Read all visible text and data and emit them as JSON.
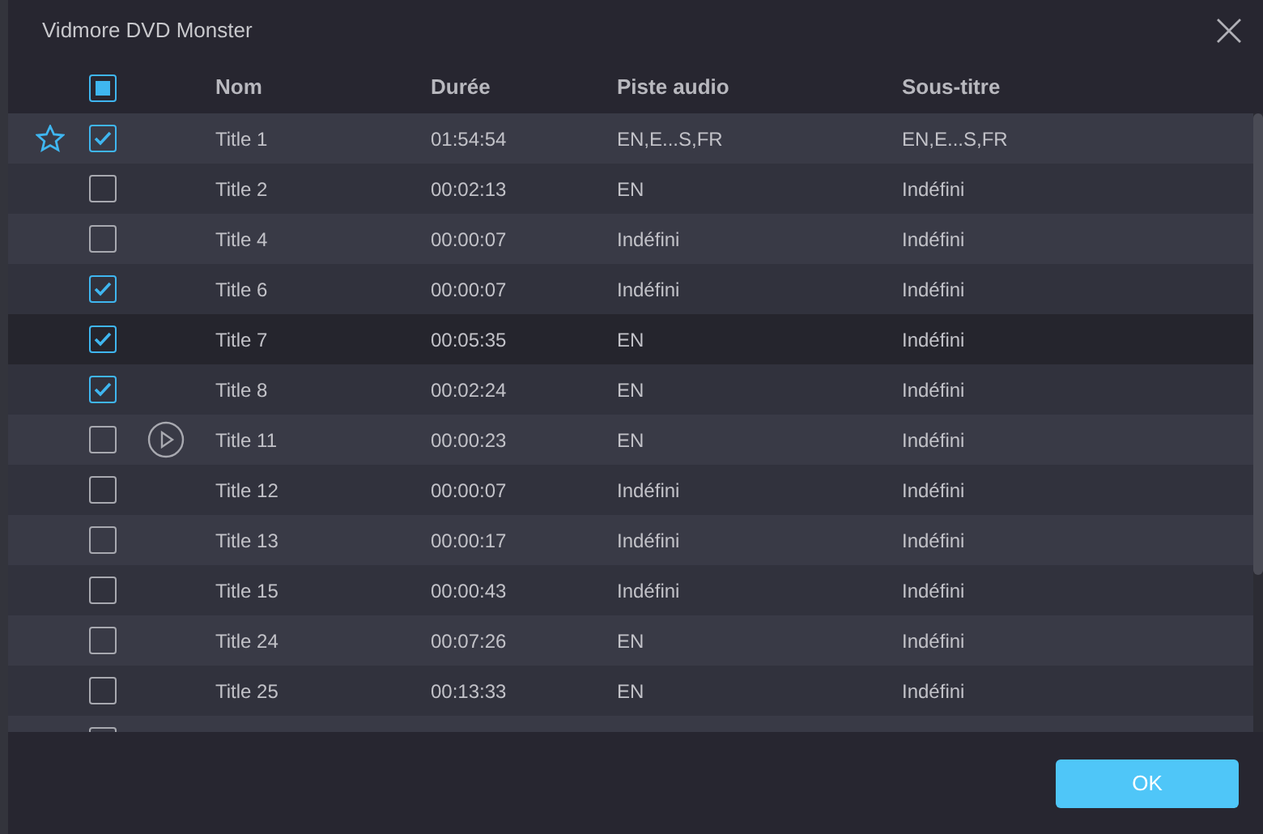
{
  "window": {
    "title": "Vidmore DVD Monster"
  },
  "table": {
    "select_all": {
      "indeterminate": true
    },
    "columns": [
      "Nom",
      "Durée",
      "Piste audio",
      "Sous-titre"
    ],
    "rows": [
      {
        "checked": true,
        "starred": true,
        "preview": false,
        "selected": false,
        "cells": [
          "Title 1",
          "01:54:54",
          "EN,E...S,FR",
          "EN,E...S,FR"
        ]
      },
      {
        "checked": false,
        "starred": false,
        "preview": false,
        "selected": false,
        "cells": [
          "Title 2",
          "00:02:13",
          "EN",
          "Indéfini"
        ]
      },
      {
        "checked": false,
        "starred": false,
        "preview": false,
        "selected": false,
        "cells": [
          "Title 4",
          "00:00:07",
          "Indéfini",
          "Indéfini"
        ]
      },
      {
        "checked": true,
        "starred": false,
        "preview": false,
        "selected": false,
        "cells": [
          "Title 6",
          "00:00:07",
          "Indéfini",
          "Indéfini"
        ]
      },
      {
        "checked": true,
        "starred": false,
        "preview": false,
        "selected": true,
        "cells": [
          "Title 7",
          "00:05:35",
          "EN",
          "Indéfini"
        ]
      },
      {
        "checked": true,
        "starred": false,
        "preview": false,
        "selected": false,
        "cells": [
          "Title 8",
          "00:02:24",
          "EN",
          "Indéfini"
        ]
      },
      {
        "checked": false,
        "starred": false,
        "preview": true,
        "selected": false,
        "cells": [
          "Title 11",
          "00:00:23",
          "EN",
          "Indéfini"
        ]
      },
      {
        "checked": false,
        "starred": false,
        "preview": false,
        "selected": false,
        "cells": [
          "Title 12",
          "00:00:07",
          "Indéfini",
          "Indéfini"
        ]
      },
      {
        "checked": false,
        "starred": false,
        "preview": false,
        "selected": false,
        "cells": [
          "Title 13",
          "00:00:17",
          "Indéfini",
          "Indéfini"
        ]
      },
      {
        "checked": false,
        "starred": false,
        "preview": false,
        "selected": false,
        "cells": [
          "Title 15",
          "00:00:43",
          "Indéfini",
          "Indéfini"
        ]
      },
      {
        "checked": false,
        "starred": false,
        "preview": false,
        "selected": false,
        "cells": [
          "Title 24",
          "00:07:26",
          "EN",
          "Indéfini"
        ]
      },
      {
        "checked": false,
        "starred": false,
        "preview": false,
        "selected": false,
        "cells": [
          "Title 25",
          "00:13:33",
          "EN",
          "Indéfini"
        ]
      },
      {
        "checked": false,
        "starred": false,
        "preview": false,
        "selected": false
      }
    ]
  },
  "buttons": [
    "OK"
  ]
}
